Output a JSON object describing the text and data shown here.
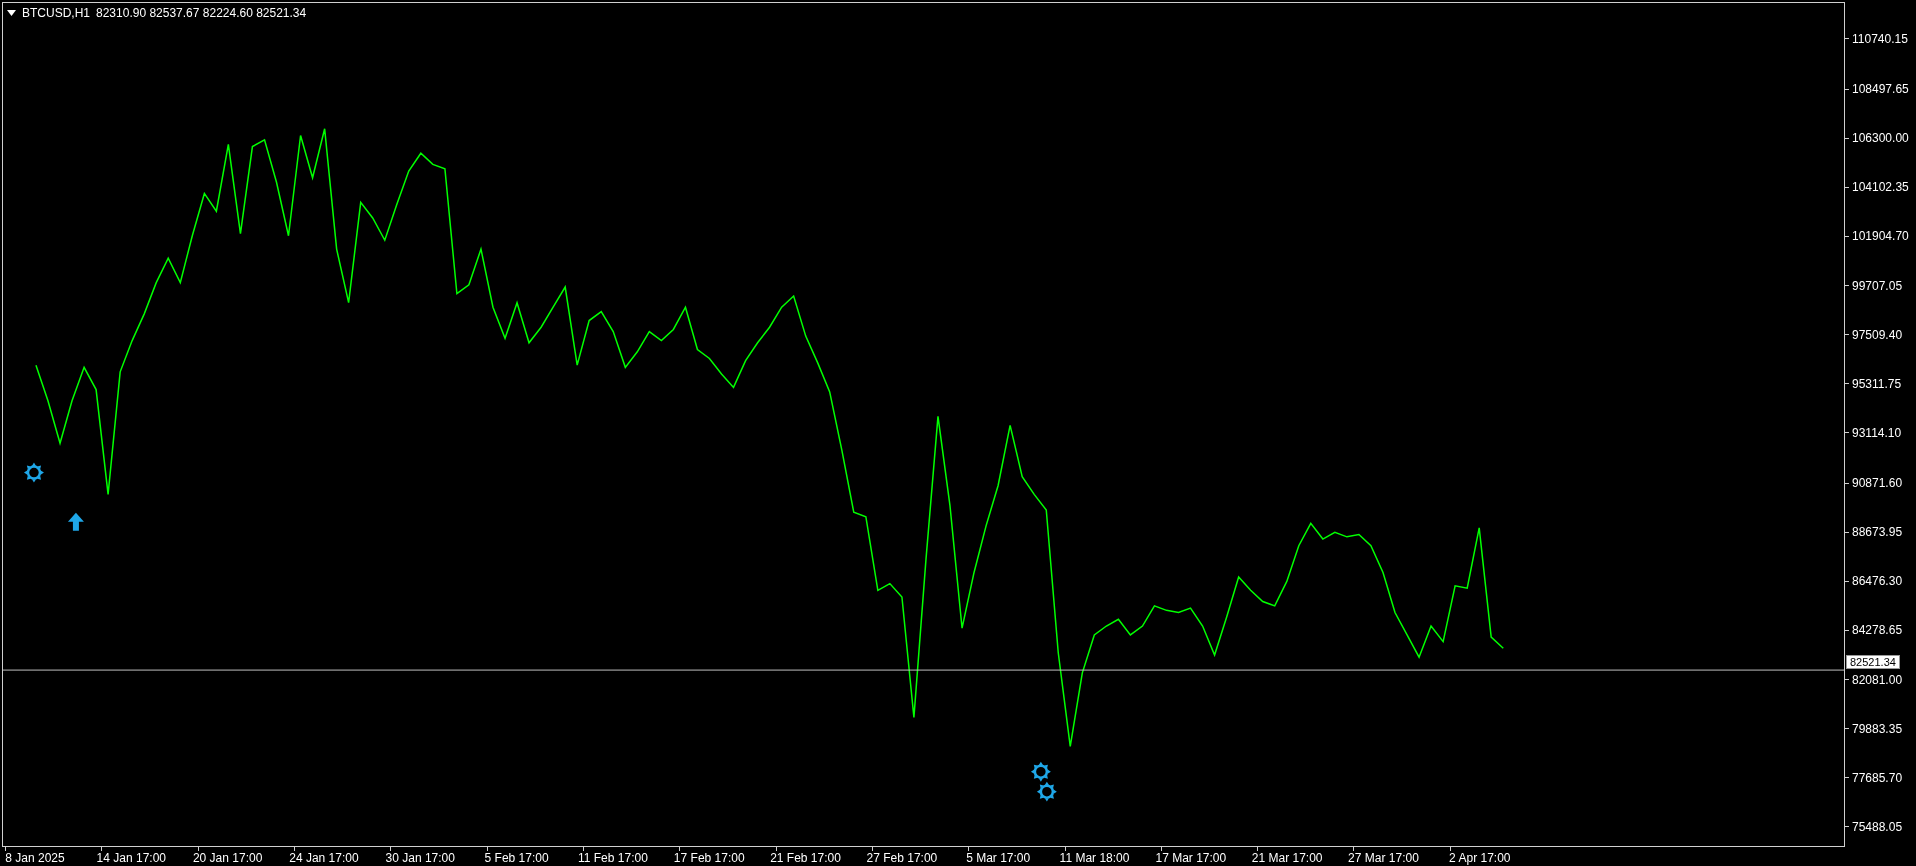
{
  "header": {
    "symbol": "BTCUSD,H1",
    "ohlc": "82310.90 82537.67 82224.60 82521.34"
  },
  "chart_data": {
    "type": "line",
    "categories": [
      "8 Jan 2025",
      null,
      null,
      null,
      null,
      null,
      null,
      null,
      "14 Jan 17:00",
      null,
      null,
      null,
      null,
      null,
      null,
      null,
      "20 Jan 17:00",
      null,
      null,
      null,
      null,
      null,
      null,
      null,
      "24 Jan 17:00",
      null,
      null,
      null,
      null,
      null,
      null,
      null,
      "30 Jan 17:00",
      null,
      null,
      null,
      null,
      null,
      null,
      null,
      "5 Feb 17:00",
      null,
      null,
      null,
      null,
      null,
      null,
      null,
      "11 Feb 17:00",
      null,
      null,
      null,
      null,
      null,
      null,
      null,
      "17 Feb 17:00",
      null,
      null,
      null,
      null,
      null,
      null,
      null,
      "21 Feb 17:00",
      null,
      null,
      null,
      null,
      null,
      null,
      null,
      "27 Feb 17:00",
      null,
      null,
      null,
      null,
      null,
      null,
      null,
      "5 Mar 17:00",
      null,
      null,
      null,
      null,
      null,
      null,
      null,
      "11 Mar 18:00",
      null,
      null,
      null,
      null,
      null,
      null,
      null,
      "17 Mar 17:00",
      null,
      null,
      null,
      null,
      null,
      null,
      null,
      "21 Mar 17:00",
      null,
      null,
      null,
      null,
      null,
      null,
      null,
      "27 Mar 17:00",
      null,
      null,
      null,
      null,
      null,
      null,
      null,
      "2 Apr 17:00",
      null,
      null
    ],
    "series": [
      {
        "color": "#00ff00",
        "values": [
          96200,
          94600,
          92700,
          94600,
          96100,
          95100,
          90400,
          95900,
          97300,
          98500,
          99900,
          101000,
          99900,
          102000,
          103900,
          103100,
          106100,
          102100,
          106000,
          106300,
          104400,
          102000,
          106500,
          104600,
          106800,
          101400,
          99000,
          103500,
          102800,
          101800,
          103400,
          104900,
          105700,
          105200,
          105000,
          99400,
          99800,
          101400,
          98800,
          97400,
          99000,
          97200,
          97900,
          98800,
          99700,
          96200,
          98200,
          98600,
          97700,
          96100,
          96800,
          97700,
          97300,
          97800,
          98800,
          96900,
          96500,
          95800,
          95200,
          96400,
          97200,
          97900,
          98800,
          99300,
          97500,
          96300,
          95000,
          92400,
          89600,
          89400,
          86100,
          86400,
          85800,
          80400,
          87500,
          93900,
          89900,
          84400,
          86900,
          89000,
          90800,
          93500,
          91200,
          90400,
          89700,
          83300,
          79100,
          82400,
          84100,
          84500,
          84800,
          84100,
          84500,
          85400,
          85200,
          85100,
          85300,
          84500,
          83200,
          84900,
          86700,
          86100,
          85600,
          85400,
          86500,
          88100,
          89100,
          88400,
          88700,
          88500,
          88600,
          88100,
          86900,
          85100,
          84100,
          83100,
          84500,
          83800,
          86300,
          86200,
          88900,
          84000,
          83500
        ]
      }
    ],
    "ylim": [
      74632,
      112440
    ],
    "yticks": [
      {
        "value": 110740.15,
        "label": "110740.15"
      },
      {
        "value": 108497.65,
        "label": "108497.65"
      },
      {
        "value": 106300,
        "label": "106300.00"
      },
      {
        "value": 104102.35,
        "label": "104102.35"
      },
      {
        "value": 101904.7,
        "label": "101904.70"
      },
      {
        "value": 99707.05,
        "label": "99707.05"
      },
      {
        "value": 97509.4,
        "label": "97509.40"
      },
      {
        "value": 95311.75,
        "label": "95311.75"
      },
      {
        "value": 93114.1,
        "label": "93114.10"
      },
      {
        "value": 90871.6,
        "label": "90871.60"
      },
      {
        "value": 88673.95,
        "label": "88673.95"
      },
      {
        "value": 86476.3,
        "label": "86476.30"
      },
      {
        "value": 84278.65,
        "label": "84278.65"
      },
      {
        "value": 82081,
        "label": "82081.00"
      },
      {
        "value": 79883.35,
        "label": "79883.35"
      },
      {
        "value": 77685.7,
        "label": "77685.70"
      },
      {
        "value": 75488.05,
        "label": "75488.05"
      }
    ],
    "ref_lines": [
      {
        "axis": "y",
        "value": 82521.34,
        "label": "82521.34"
      }
    ]
  }
}
